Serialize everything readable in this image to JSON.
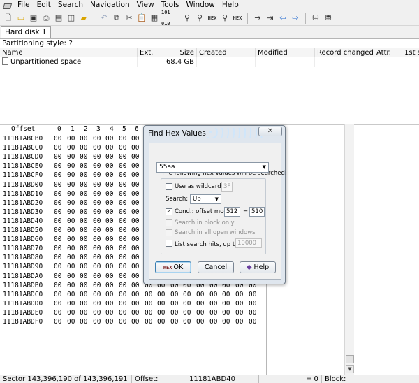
{
  "menu": [
    "File",
    "Edit",
    "Search",
    "Navigation",
    "View",
    "Tools",
    "Window",
    "Help"
  ],
  "toolbar": {
    "hex_search_label": "HEX",
    "disk_label": "101 010"
  },
  "tab": {
    "label": "Hard disk 1"
  },
  "partition": {
    "text": "Partitioning style: ?"
  },
  "file_list": {
    "columns": [
      "Name",
      "Ext.",
      "Size",
      "Created",
      "Modified",
      "Record changed",
      "Attr.",
      "1st s"
    ],
    "rows": [
      {
        "name": "Unpartitioned space",
        "ext": "",
        "size": "68.4 GB",
        "created": "",
        "modified": "",
        "record_changed": "",
        "attr": ""
      }
    ]
  },
  "hex": {
    "offset_label": "Offset",
    "columns": [
      "0",
      "1",
      "2",
      "3",
      "4",
      "5",
      "6"
    ],
    "offsets": [
      "11181ABCB0",
      "11181ABCC0",
      "11181ABCD0",
      "11181ABCE0",
      "11181ABCF0",
      "11181ABD00",
      "11181ABD10",
      "11181ABD20",
      "11181ABD30",
      "11181ABD40",
      "11181ABD50",
      "11181ABD60",
      "11181ABD70",
      "11181ABD80",
      "11181ABD90",
      "11181ABDA0",
      "11181ABDB0",
      "11181ABDC0",
      "11181ABDD0",
      "11181ABDE0",
      "11181ABDF0"
    ],
    "byte": "00"
  },
  "status": {
    "sector": "Sector 143,396,190 of 143,396,191",
    "offset_label": "Offset:",
    "offset_value": "11181ABD40",
    "value": "= 0",
    "block_label": "Block:"
  },
  "dialog": {
    "title": "Find Hex Values",
    "close_label": "✕",
    "prompt": "The following hex values will be searched:",
    "search_value": "55aa",
    "wildcard_label": "Use as wildcard:",
    "wildcard_value": "3F",
    "search_label": "Search:",
    "direction": "Up",
    "cond_label": "Cond.: offset mod",
    "cond_mod": "512",
    "cond_eq": "=",
    "cond_value": "510",
    "block_only_label": "Search in block only",
    "all_windows_label": "Search in all open windows",
    "list_hits_label": "List search hits, up to",
    "list_hits_sup": "2",
    "list_hits_value": "10000",
    "ok_label": "OK",
    "ok_glyph": "HEX",
    "cancel_label": "Cancel",
    "help_label": "Help"
  }
}
